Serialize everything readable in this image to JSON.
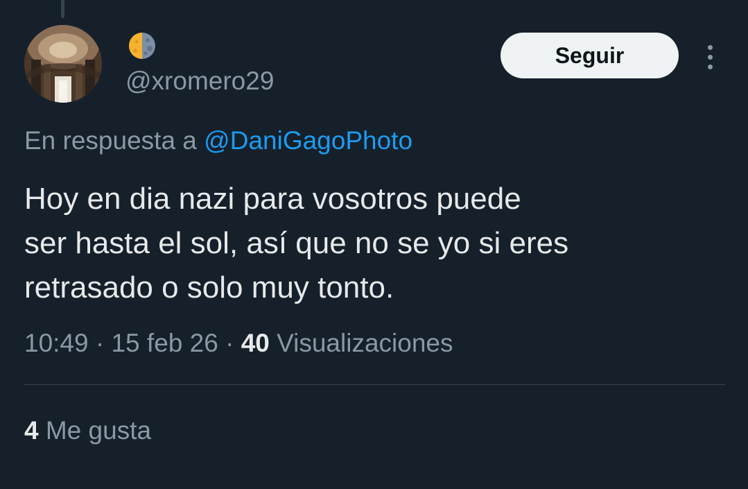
{
  "tweet": {
    "author": {
      "display_name_icon": "moon-emoji-icon",
      "handle": "@xromero29"
    },
    "follow_label": "Seguir",
    "more_icon": "more-options-icon",
    "reply_prefix": "En respuesta a",
    "reply_mention": "@DaniGagoPhoto",
    "text_lines": [
      "Hoy en dia nazi para vosotros puede",
      "ser hasta el sol, así que no se yo si eres",
      "retrasado o solo muy tonto."
    ],
    "time": "10:49",
    "date": "15 feb 26",
    "separator": "·",
    "views_count": "40",
    "views_label": "Visualizaciones",
    "likes_count": "4",
    "likes_label": "Me gusta"
  },
  "colors": {
    "background": "#15202b",
    "primary_text": "#e7e9ea",
    "secondary_text": "#8b98a5",
    "accent": "#1d9bf0",
    "button_bg": "#eff3f4",
    "divider": "#38444d"
  }
}
